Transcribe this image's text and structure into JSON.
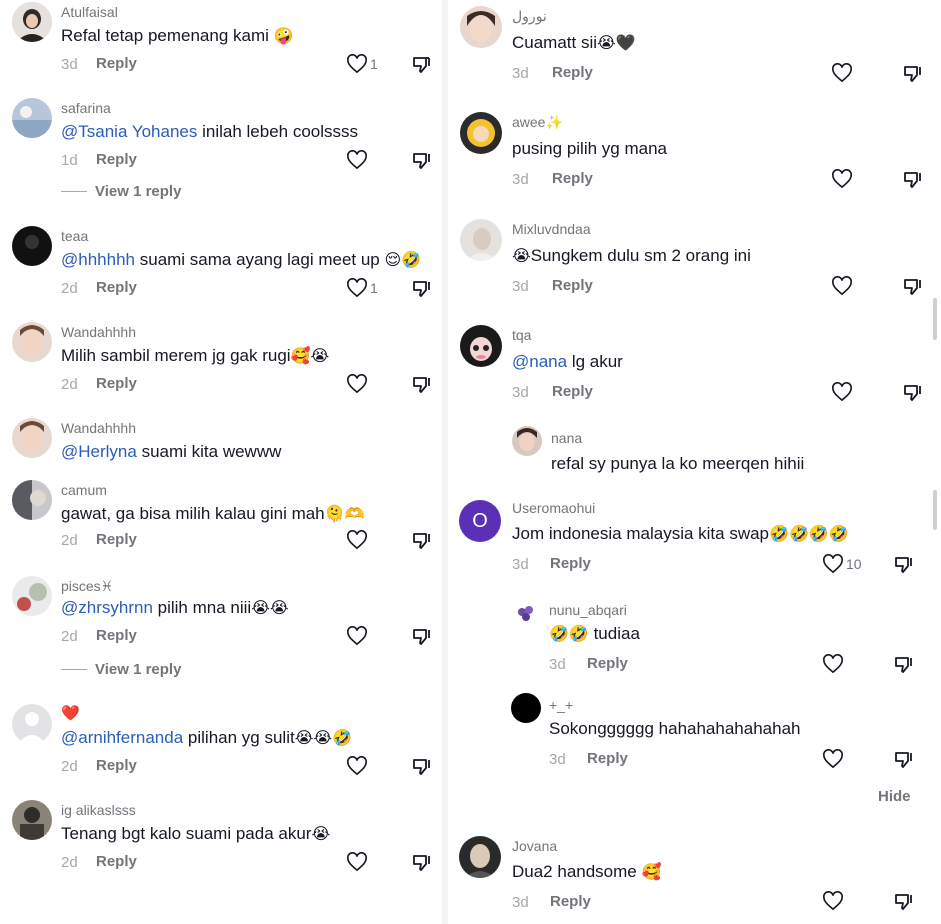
{
  "left": [
    {
      "user": "Atulfaisal",
      "text": "Refal tetap pemenang kami",
      "emoji": "🤪",
      "time": "3d",
      "reply": "Reply",
      "likes": "1"
    },
    {
      "user": "safarina",
      "mention": "@Tsania Yohanes",
      "text": "inilah lebeh coolssss",
      "time": "1d",
      "reply": "Reply",
      "view": "View 1 reply"
    },
    {
      "user": "teaa",
      "mention": "@hhhhhh",
      "text": "suami sama ayang lagi meet up",
      "emoji": "😌🤣",
      "time": "2d",
      "reply": "Reply",
      "likes": "1"
    },
    {
      "user": "Wandahhhh",
      "text": "Milih sambil merem jg gak rugi",
      "emoji": "🥰😭",
      "time": "2d",
      "reply": "Reply"
    },
    {
      "user": "Wandahhhh",
      "mention": "@Herlyna",
      "text": "suami kita wewww",
      "time": "",
      "reply": ""
    },
    {
      "user": "camum",
      "text": "gawat, ga bisa milih kalau gini mah",
      "emoji": "🫠🫶",
      "time": "2d",
      "reply": "Reply"
    },
    {
      "user": "pisces♓",
      "mention": "@zhrsyhrnn",
      "text": "pilih mna niii",
      "emoji": "😭😭",
      "time": "2d",
      "reply": "Reply",
      "view": "View 1 reply"
    },
    {
      "user": "❤️",
      "mention": "@arnihfernanda",
      "text": "pilihan yg sulit",
      "emoji": "😭😭🤣",
      "time": "2d",
      "reply": "Reply"
    },
    {
      "user": "ig alikaslsss",
      "text": "Tenang bgt kalo suami pada akur",
      "emoji": "😭",
      "time": "2d",
      "reply": "Reply"
    }
  ],
  "right": [
    {
      "user": "نورول",
      "text": "Cuamatt sii",
      "emoji": "😭🖤",
      "time": "3d",
      "reply": "Reply"
    },
    {
      "user": "awee✨",
      "text": "pusing pilih yg mana",
      "time": "3d",
      "reply": "Reply"
    },
    {
      "user": "Mixluvdndaa",
      "text": "Sungkem dulu sm 2 orang ini",
      "emoji_pre": "😭",
      "time": "3d",
      "reply": "Reply"
    },
    {
      "user": "tqa",
      "mention": "@nana",
      "text": "lg akur",
      "time": "3d",
      "reply": "Reply"
    },
    {
      "user": "nana",
      "text": "refal sy punya la ko meerqen hihii",
      "time": "",
      "reply": ""
    },
    {
      "user": "Useromaohui",
      "text": "Jom indonesia malaysia kita swap",
      "emoji": "🤣🤣🤣🤣",
      "time": "3d",
      "reply": "Reply",
      "likes": "10"
    },
    {
      "user": "nunu_abqari",
      "text": "tudiaa",
      "emoji_pre": "🤣🤣",
      "time": "3d",
      "reply": "Reply"
    },
    {
      "user": "+_+",
      "text": "Sokongggggg hahahahahahahah",
      "time": "3d",
      "reply": "Reply"
    },
    {
      "user": "Jovana",
      "text": "Dua2 handsome",
      "emoji": "🥰",
      "time": "3d",
      "reply": "Reply"
    }
  ],
  "hide_label": "Hide",
  "avatar_initial": "O"
}
